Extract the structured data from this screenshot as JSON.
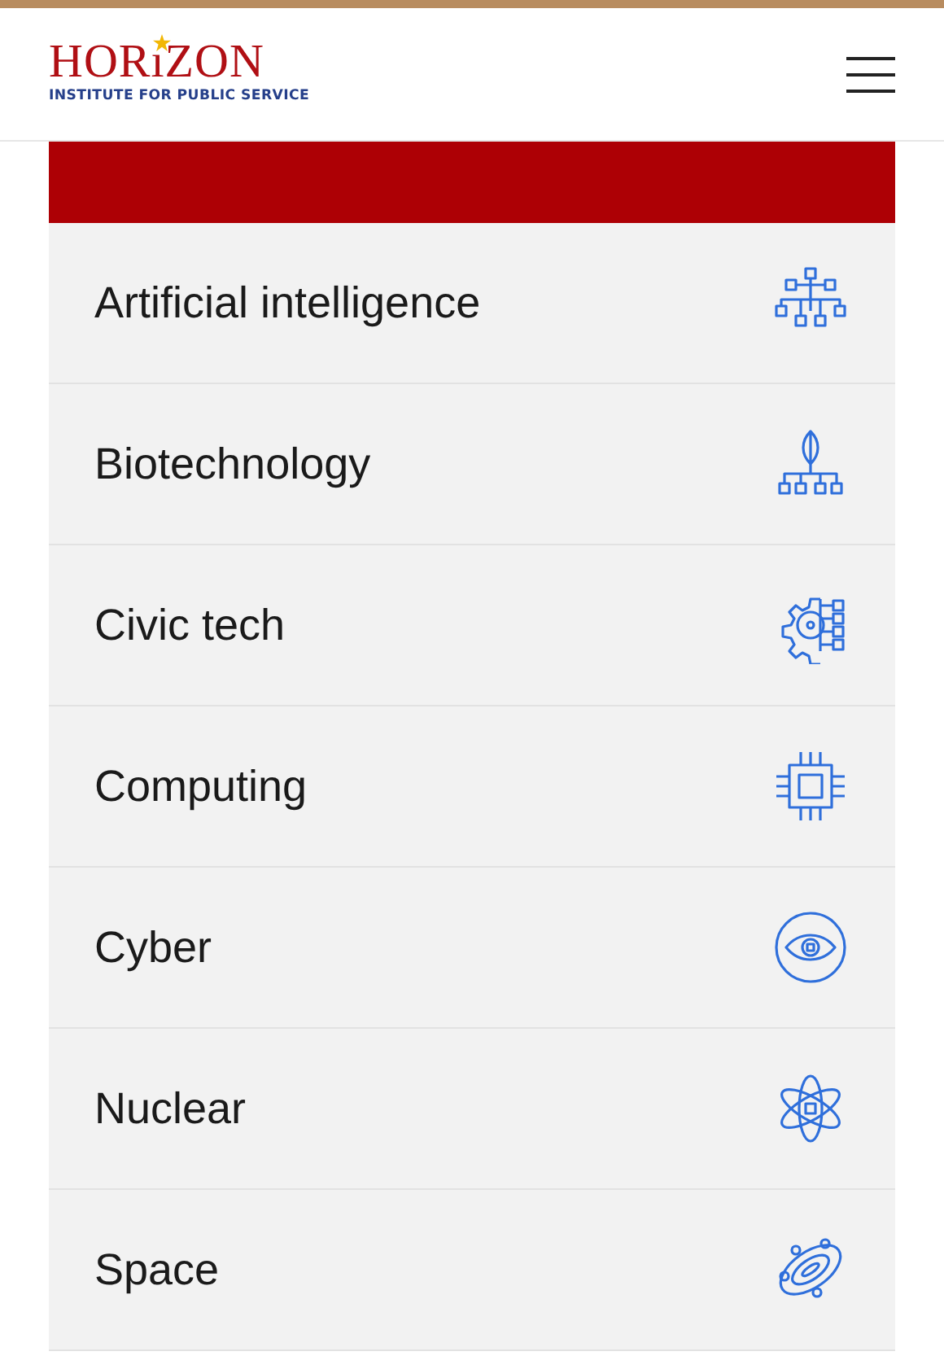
{
  "header": {
    "logo": {
      "name": "HORıZON",
      "tagline": "INSTITUTE FOR PUBLIC SERVICE"
    }
  },
  "topics": [
    {
      "label": "Artificial intelligence",
      "kind": "network"
    },
    {
      "label": "Biotechnology",
      "kind": "leaf"
    },
    {
      "label": "Civic tech",
      "kind": "gear"
    },
    {
      "label": "Computing",
      "kind": "chip"
    },
    {
      "label": "Cyber",
      "kind": "eye"
    },
    {
      "label": "Nuclear",
      "kind": "atom"
    },
    {
      "label": "Space",
      "kind": "orbit"
    }
  ]
}
